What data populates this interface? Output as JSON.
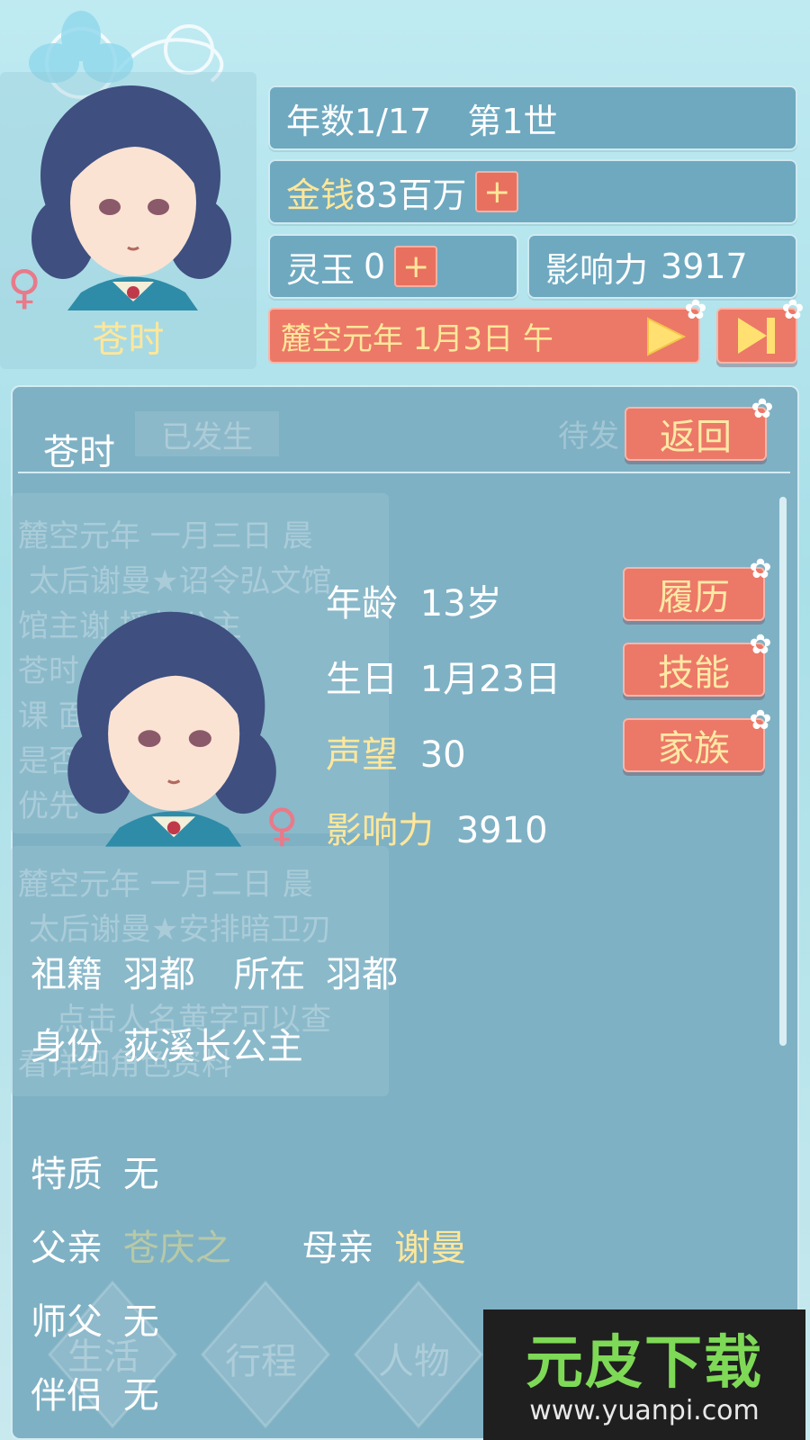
{
  "header": {
    "character_name": "苍时",
    "gender_symbol": "♀",
    "year_count": "年数1/17",
    "generation": "第1世",
    "money_label": "金钱",
    "money_value": "83百万",
    "jade_label": "灵玉",
    "jade_value": "0",
    "influence_label": "影响力",
    "influence_value": "3917",
    "date": "麓空元年 1月3日 午",
    "plus_symbol": "+"
  },
  "controls": {
    "play_icon": "play-icon",
    "skip_icon": "skip-forward-icon"
  },
  "panel": {
    "name": "苍时",
    "back_label": "返回",
    "bg_tab_happened": "已发生",
    "bg_tab_pending": "待发"
  },
  "profile": {
    "age_label": "年龄",
    "age_value": "13岁",
    "birthday_label": "生日",
    "birthday_value": "1月23日",
    "reputation_label": "声望",
    "reputation_value": "30",
    "influence_label": "影响力",
    "influence_value": "3910",
    "gender_symbol": "♀",
    "resume_button": "履历",
    "skills_button": "技能",
    "family_button": "家族",
    "origin_label": "祖籍",
    "origin_value": "羽都",
    "location_label": "所在",
    "location_value": "羽都",
    "identity_label": "身份",
    "identity_value": "荻溪长公主",
    "trait_label": "特质",
    "trait_value": "无",
    "father_label": "父亲",
    "father_value": "苍庆之",
    "mother_label": "母亲",
    "mother_value": "谢曼",
    "master_label": "师父",
    "master_value": "无",
    "partner_label": "伴侣",
    "partner_value": "无"
  },
  "background_log": [
    "麓空元年 一月三日 晨",
    "太后谢曼★诏令弘文馆",
    "馆主谢 授长公主",
    "苍时 想去",
    "课 面设定",
    "是否 课程的",
    "优先",
    "麓空元年 一月二日 晨",
    "太后谢曼★安排暗卫刃",
    "点击人名黄字可以查",
    "看详细角色资料"
  ],
  "bottom_nav": [
    "生活",
    "行程",
    "人物"
  ],
  "watermark": {
    "title": "元皮下载",
    "url": "www.yuanpi.com"
  },
  "colors": {
    "panel": "#7fb1c4",
    "bar": "#6ea9c0",
    "button_red": "#ec7868",
    "gold_text": "#ffe79a",
    "sky": "#bfeaf2"
  }
}
